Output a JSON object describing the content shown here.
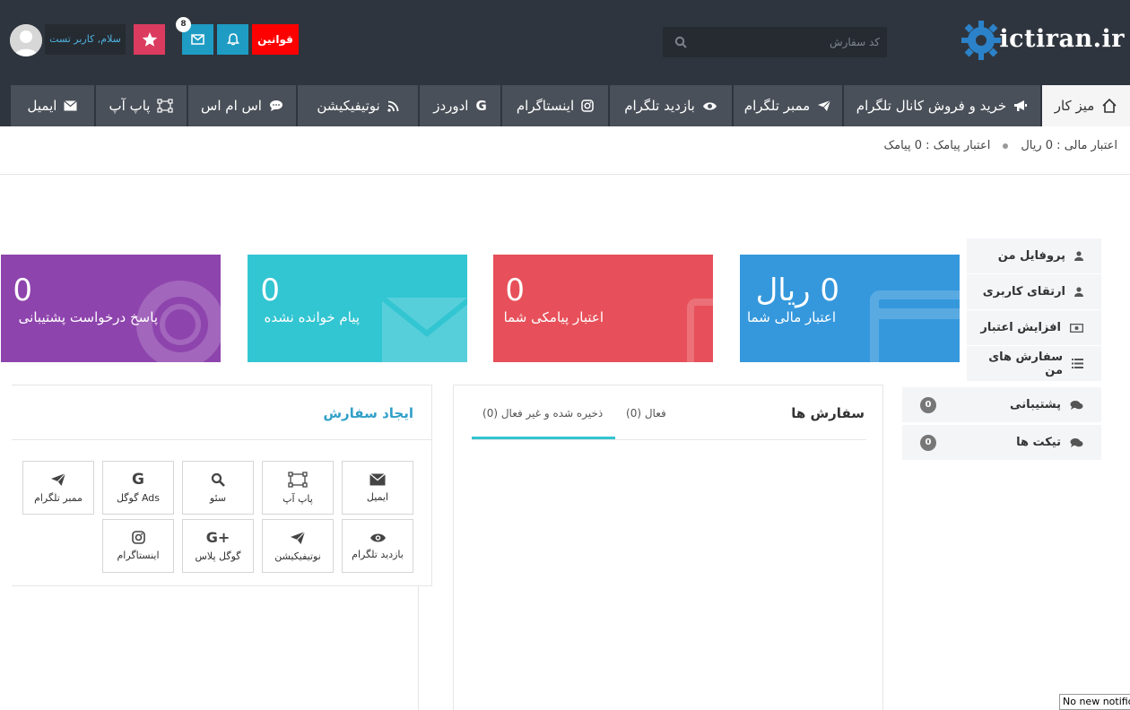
{
  "header": {
    "logo_text": "ictiran.ir",
    "search_placeholder": "کد سفارش",
    "rules_label": "قوانین",
    "mail_count": "8",
    "user_greeting": "سلام, کاربر تست"
  },
  "nav": {
    "tabs": [
      {
        "label": "میز کار",
        "icon": "home-icon"
      },
      {
        "label": "خرید و فروش کانال تلگرام",
        "icon": "bullhorn-icon"
      },
      {
        "label": "ممبر تلگرام",
        "icon": "paper-plane-icon"
      },
      {
        "label": "بازدید تلگرام",
        "icon": "eye-icon"
      },
      {
        "label": "اینستاگرام",
        "icon": "instagram-icon"
      },
      {
        "label": "ادوردز",
        "icon": "google-icon"
      },
      {
        "label": "نوتیفیکیشن",
        "icon": "rss-icon"
      },
      {
        "label": "اس ام اس",
        "icon": "comment-icon"
      },
      {
        "label": "پاپ آپ",
        "icon": "vector-square-icon"
      },
      {
        "label": "ایمیل",
        "icon": "envelope-icon"
      }
    ]
  },
  "credit": {
    "money": "اعتبار مالی : 0 ریال",
    "sms": "اعتبار پیامک : 0 پیامک"
  },
  "sidebar": {
    "items": [
      {
        "label": "پروفایل من",
        "icon": "user-icon"
      },
      {
        "label": "ارتقای کاربری",
        "icon": "user-up-icon"
      },
      {
        "label": "افزایش اعتبار",
        "icon": "money-icon"
      },
      {
        "label": "سفارش های من",
        "icon": "list-icon"
      },
      {
        "label": "پشتیبانی",
        "icon": "comments-icon",
        "badge": "0"
      },
      {
        "label": "تیکت ها",
        "icon": "comments-icon",
        "badge": "0"
      }
    ]
  },
  "stats": [
    {
      "num": "0 ریال",
      "caption": "اعتبار مالی شما",
      "color": "#3598dc"
    },
    {
      "num": "0",
      "caption": "اعتبار پیامکی شما",
      "color": "#e7505a"
    },
    {
      "num": "0",
      "caption": "پیام خوانده نشده",
      "color": "#32c5d2"
    },
    {
      "num": "0",
      "caption": "پاسخ درخواست پشتیبانی",
      "color": "#8e44ad"
    }
  ],
  "orders": {
    "title": "سفارش ها",
    "tab_active": "فعال (0)",
    "tab_saved": "ذخیره شده و غیر فعال (0)"
  },
  "create_order": {
    "title": "ایجاد سفارش",
    "tiles_row1": [
      "ایمیل",
      "پاپ آپ",
      "سئو",
      "گوگل Ads",
      "ممبر تلگرام"
    ],
    "tiles_row2": [
      "بازدید تلگرام",
      "نوتیفیکیشن",
      "گوگل پلاس",
      "اینستاگرام"
    ]
  },
  "notification_text": "No new notifications"
}
